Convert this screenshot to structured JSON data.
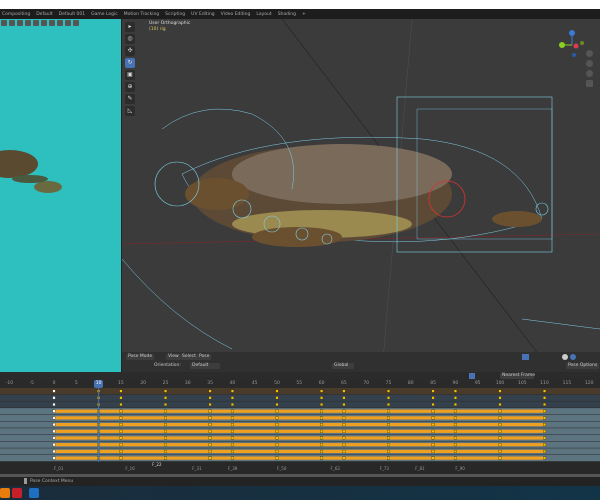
{
  "workspace_tabs": [
    "Compositing",
    "Default",
    "Default 001",
    "Game Logic",
    "Motion Tracking",
    "Scripting",
    "UV Editing",
    "Video Editing",
    "Layout",
    "Shading",
    "+"
  ],
  "viewport": {
    "title": "User Orthographic",
    "subtitle": "(10) rig",
    "mode": "Pose Mode",
    "menus": [
      "View",
      "Select",
      "Pose"
    ],
    "orientation_label": "Orientation:",
    "orientation_value": "Default",
    "transform_orientation": "Global",
    "pose_options": "Pose Options"
  },
  "toolbar_icons": [
    "cursor-select-icon",
    "cursor-icon",
    "move-icon",
    "rotate-icon",
    "scale-icon",
    "transform-icon",
    "annotate-icon",
    "measure-icon"
  ],
  "timeline": {
    "interpolation": "Nearest Frame",
    "current_frame": "10",
    "ruler": [
      "-10",
      "-5",
      "0",
      "5",
      "10",
      "15",
      "20",
      "25",
      "30",
      "35",
      "40",
      "45",
      "50",
      "55",
      "60",
      "65",
      "70",
      "75",
      "80",
      "85",
      "90",
      "95",
      "100",
      "105",
      "110",
      "115",
      "120"
    ],
    "keyframes": [
      0,
      10,
      15,
      25,
      35,
      40,
      50,
      60,
      65,
      75,
      85,
      90,
      100,
      110
    ],
    "markers": [
      {
        "label": "F_01",
        "frame": 0
      },
      {
        "label": "F_16",
        "frame": 16
      },
      {
        "label": "F_22",
        "frame": 22
      },
      {
        "label": "F_31",
        "frame": 31
      },
      {
        "label": "F_39",
        "frame": 39
      },
      {
        "label": "F_50",
        "frame": 50
      },
      {
        "label": "F_62",
        "frame": 62
      },
      {
        "label": "F_73",
        "frame": 73
      },
      {
        "label": "F_81",
        "frame": 81
      },
      {
        "label": "F_90",
        "frame": 90
      }
    ]
  },
  "status": {
    "context": "Pose Context Menu"
  },
  "colors": {
    "accent": "#4772b3",
    "keyframe": "#f0a020",
    "viewport_bg": "#3b3b3b",
    "left_bg": "#2ebfbf",
    "rig": "#7fd0e8"
  }
}
